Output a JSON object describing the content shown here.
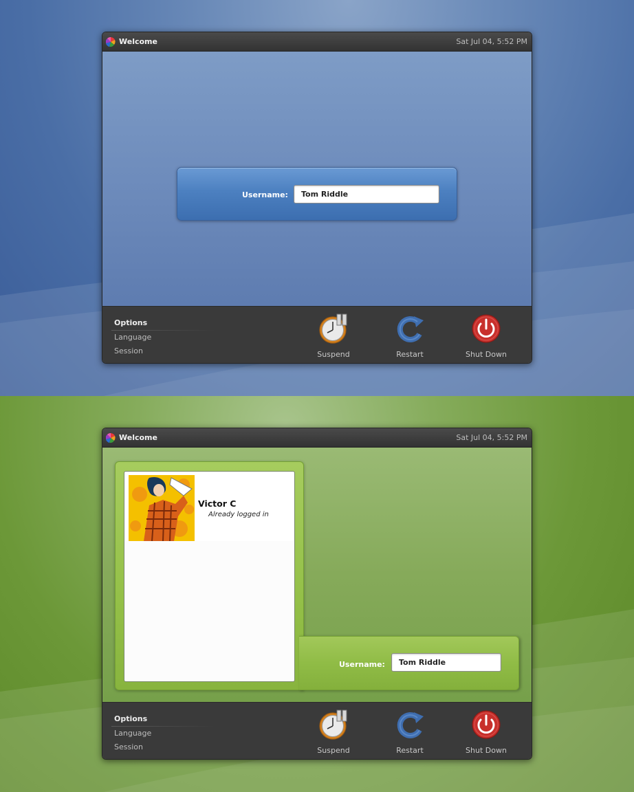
{
  "screens": [
    {
      "theme": "blue",
      "window": {
        "title": "Welcome",
        "clock": "Sat Jul 04,  5:52 PM"
      },
      "login": {
        "username_label": "Username:",
        "username_value": "Tom Riddle"
      },
      "options": {
        "title": "Options",
        "items": [
          "Language",
          "Session"
        ]
      },
      "actions": {
        "suspend": "Suspend",
        "restart": "Restart",
        "shutdown": "Shut Down"
      }
    },
    {
      "theme": "green",
      "window": {
        "title": "Welcome",
        "clock": "Sat Jul 04,  5:52 PM"
      },
      "users": [
        {
          "name": "Victor C",
          "status": "Already logged in"
        }
      ],
      "login": {
        "username_label": "Username:",
        "username_value": "Tom Riddle"
      },
      "options": {
        "title": "Options",
        "items": [
          "Language",
          "Session"
        ]
      },
      "actions": {
        "suspend": "Suspend",
        "restart": "Restart",
        "shutdown": "Shut Down"
      }
    }
  ],
  "colors": {
    "blue_accent": "#4c80c0",
    "green_accent": "#94c048",
    "suspend_icon": "#e8932c",
    "restart_icon": "#3f6eb0",
    "shutdown_icon": "#c8302c",
    "bar_background": "#3a3a3a"
  },
  "icons": {
    "logo": "pinwheel-logo-icon",
    "suspend": "clock-pause-icon",
    "restart": "circular-arrow-icon",
    "shutdown": "power-icon"
  }
}
